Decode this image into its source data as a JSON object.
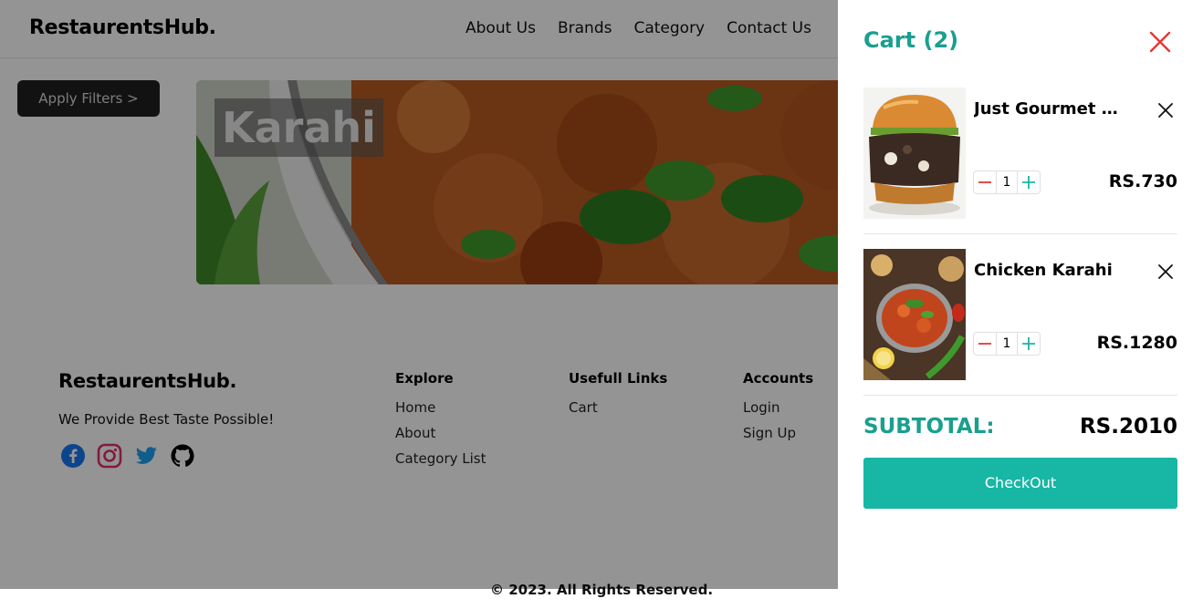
{
  "navbar": {
    "brand": "RestaurentsHub.",
    "links": [
      "About Us",
      "Brands",
      "Category",
      "Contact Us"
    ]
  },
  "filters": {
    "button_label": "Apply Filters >"
  },
  "banner": {
    "title": "Karahi"
  },
  "footer": {
    "brand": "RestaurentsHub.",
    "tagline": "We Provide Best Taste Possible!",
    "social_icons": [
      "facebook-icon",
      "instagram-icon",
      "twitter-icon",
      "github-icon"
    ],
    "columns": [
      {
        "heading": "Explore",
        "links": [
          "Home",
          "About",
          "Category List"
        ]
      },
      {
        "heading": "Usefull Links",
        "links": [
          "Cart"
        ]
      },
      {
        "heading": "Accounts",
        "links": [
          "Login",
          "Sign Up"
        ]
      }
    ],
    "copyright": "© 2023. All Rights Reserved."
  },
  "cart": {
    "title": "Cart (2)",
    "items": [
      {
        "name": "Just Gourmet Burger",
        "quantity": "1",
        "price": "RS.730"
      },
      {
        "name": "Chicken Karahi",
        "quantity": "1",
        "price": "RS.1280"
      }
    ],
    "subtotal_label": "SUBTOTAL:",
    "subtotal_value": "RS.2010",
    "checkout_label": "CheckOut"
  },
  "colors": {
    "accent": "#1a9f8f",
    "checkout_button": "#17b6a5",
    "close_red": "#e53935",
    "facebook": "#1877f2",
    "instagram": "#e1306c",
    "twitter": "#1da1f2"
  }
}
